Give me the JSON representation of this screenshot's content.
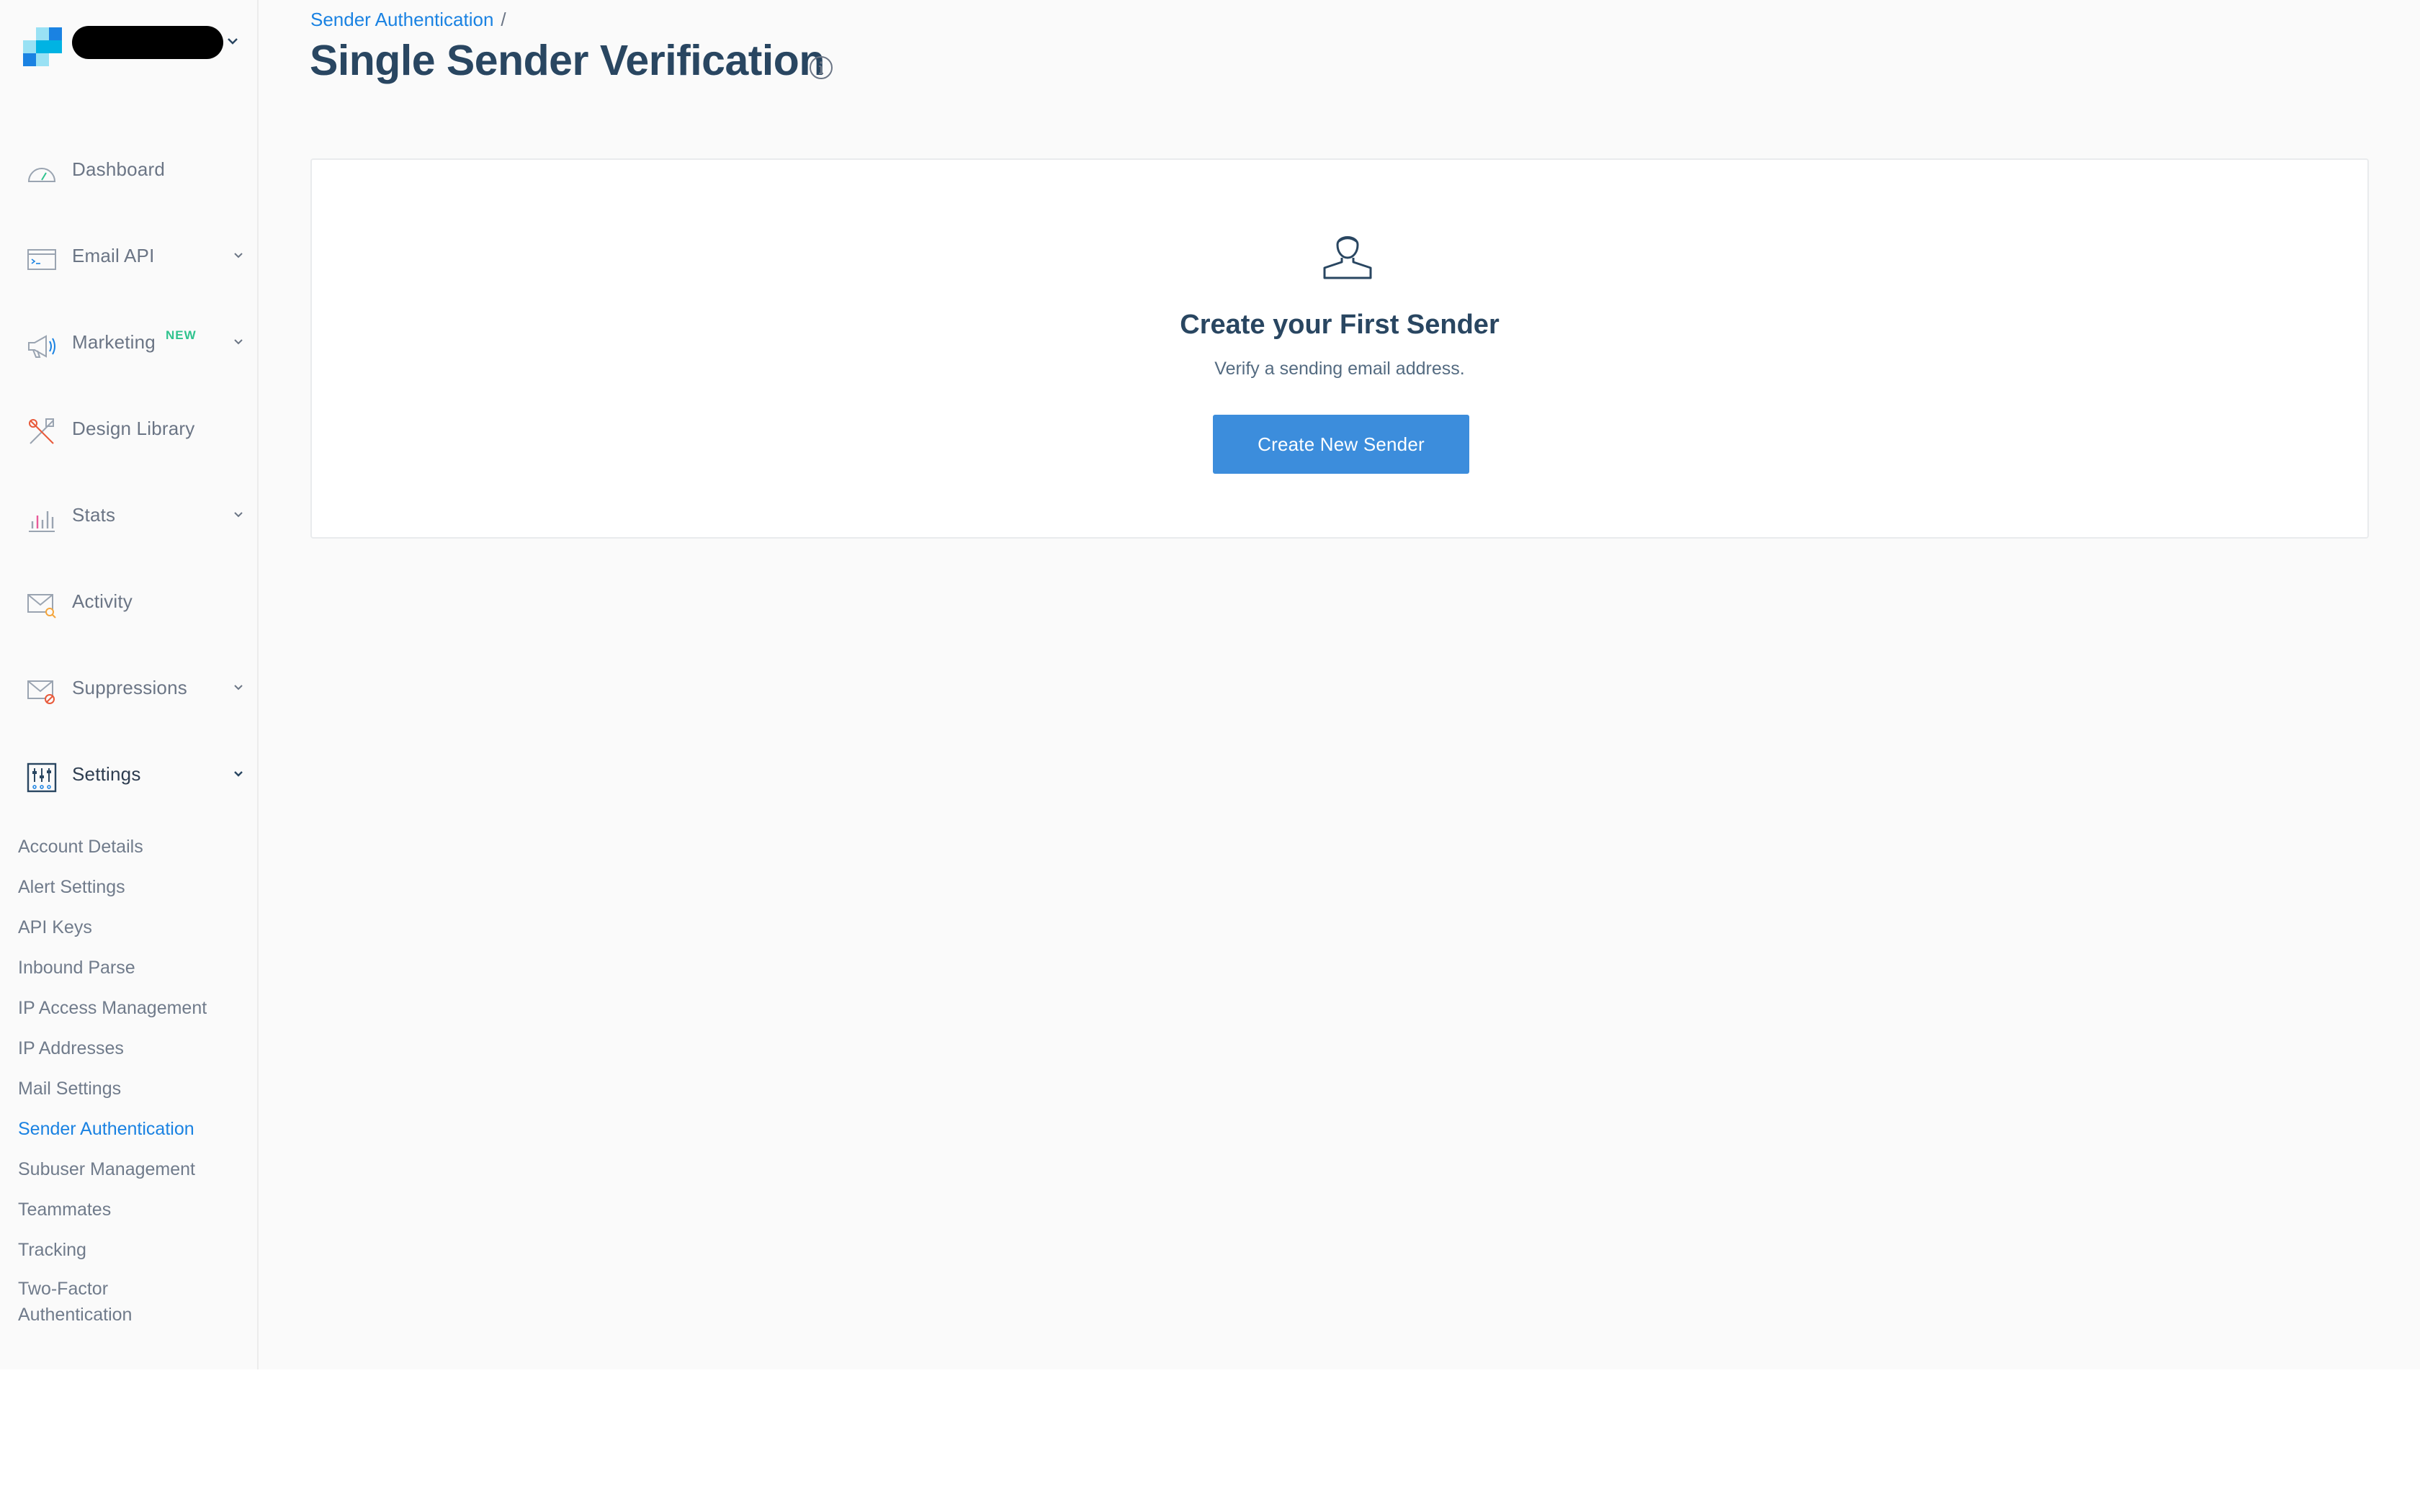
{
  "brand": {
    "logo_icon": "sendgrid-logo-icon",
    "account_caret_icon": "chevron-down-icon",
    "colors": {
      "logo_dark": "#1a82e2",
      "logo_light": "#99e1f4",
      "logo_mid": "#00b3e3"
    }
  },
  "sidebar": {
    "items": [
      {
        "label": "Dashboard",
        "icon": "dashboard-gauge-icon",
        "has_chevron": false
      },
      {
        "label": "Email API",
        "icon": "terminal-window-icon",
        "has_chevron": true
      },
      {
        "label": "Marketing",
        "badge": "NEW",
        "icon": "megaphone-icon",
        "has_chevron": true
      },
      {
        "label": "Design Library",
        "icon": "design-tools-icon",
        "has_chevron": false
      },
      {
        "label": "Stats",
        "icon": "bar-chart-icon",
        "has_chevron": true
      },
      {
        "label": "Activity",
        "icon": "envelope-search-icon",
        "has_chevron": false
      },
      {
        "label": "Suppressions",
        "icon": "envelope-blocked-icon",
        "has_chevron": true
      },
      {
        "label": "Settings",
        "icon": "settings-sliders-icon",
        "has_chevron": true,
        "expanded": true
      }
    ],
    "settings_items": [
      "Account Details",
      "Alert Settings",
      "API Keys",
      "Inbound Parse",
      "IP Access Management",
      "IP Addresses",
      "Mail Settings",
      "Sender Authentication",
      "Subuser Management",
      "Teammates",
      "Tracking",
      "Two-Factor Authentication"
    ],
    "active_settings_item": "Sender Authentication"
  },
  "header": {
    "breadcrumb_parent": "Sender Authentication",
    "breadcrumb_separator": "/",
    "title": "Single Sender Verification",
    "info_icon": "info-circle-icon"
  },
  "empty_state": {
    "icon": "user-person-icon",
    "title": "Create your First Sender",
    "subtitle": "Verify a sending email address.",
    "button_label": "Create New Sender"
  },
  "colors": {
    "accent": "#1a82e2",
    "button": "#3c8ddc",
    "title": "#294661",
    "badge_new": "#2fc38e"
  }
}
